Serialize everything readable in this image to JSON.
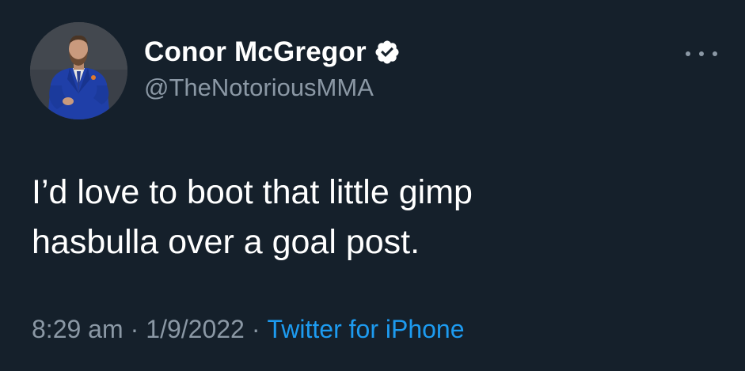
{
  "tweet": {
    "author": {
      "display_name": "Conor McGregor",
      "handle": "@TheNotoriousMMA",
      "verified": true,
      "avatar_icon": "profile-photo-man-in-blue-suit"
    },
    "text": "I’d love to boot that little gimp\nhasbulla over a goal post.",
    "time": "8:29 am",
    "date": "1/9/2022",
    "separator": "·",
    "source": "Twitter for iPhone",
    "more_icon": "more-horizontal-icon"
  },
  "colors": {
    "background": "#15202b",
    "primary_text": "#ffffff",
    "secondary_text": "#8b98a5",
    "link": "#1d9bf0",
    "verified_badge": "#ffffff"
  }
}
